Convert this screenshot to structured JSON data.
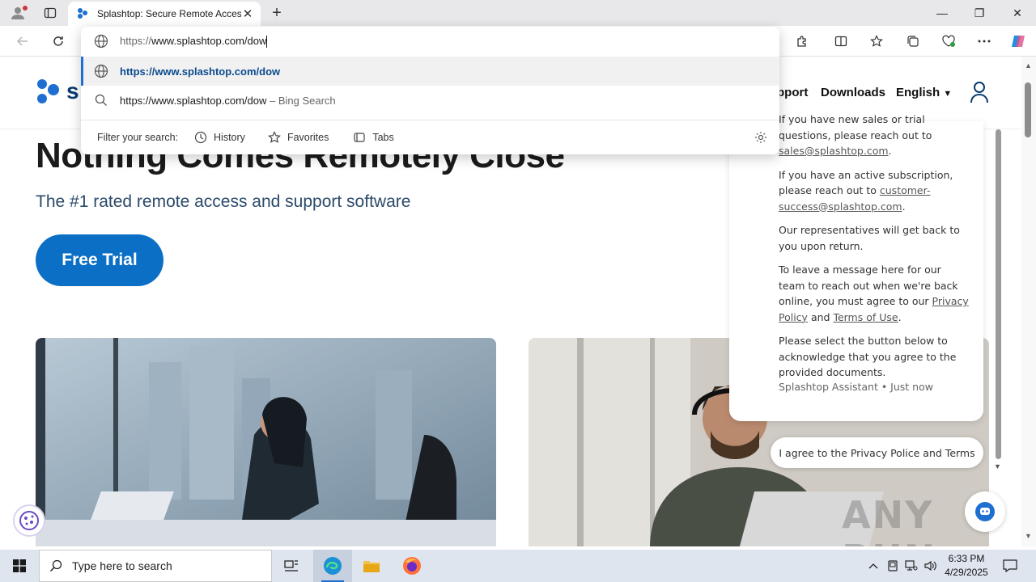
{
  "browser": {
    "tab_title": "Splashtop: Secure Remote Access",
    "new_tab": "+",
    "window_controls": {
      "minimize": "—",
      "restore": "❐",
      "close": "✕"
    }
  },
  "omnibox": {
    "typed_prefix": "https://",
    "typed_rest": "www.splashtop.com/dow",
    "suggestions": [
      {
        "text": "https://www.splashtop.com/dow",
        "suffix": "",
        "kind": "url"
      },
      {
        "text": "https://www.splashtop.com/dow",
        "suffix": " – Bing Search",
        "kind": "search"
      }
    ],
    "filter_label": "Filter your search:",
    "filters": [
      "History",
      "Favorites",
      "Tabs"
    ]
  },
  "site": {
    "logo_text": "s",
    "nav": {
      "support": "pport",
      "downloads": "Downloads",
      "language": "English"
    },
    "hero_title": "Nothing Comes Remotely Close",
    "hero_subtitle": "The #1 rated remote access and support software",
    "cta": "Free Trial"
  },
  "chat": {
    "p1_a": "If you have new sales or trial questions, please reach out to ",
    "p1_link": "sales@splashtop.com",
    "p1_b": ".",
    "p2_a": "If you have an active subscription, please reach out to ",
    "p2_link": "customer-success@splashtop.com",
    "p2_b": ".",
    "p3": "Our representatives will get back to you upon return.",
    "p4_a": "To leave a message here for our team to reach out when we're back online, you must agree to our ",
    "p4_link1": "Privacy Policy",
    "p4_and": " and ",
    "p4_link2": "Terms of Use",
    "p4_b": ".",
    "p5": "Please select the button below to acknowledge that you agree to the provided documents.",
    "meta": "Splashtop Assistant • Just now",
    "agree_button": "I agree to the Privacy Police and Terms"
  },
  "watermark": "ANY RUN",
  "taskbar": {
    "search_placeholder": "Type here to search",
    "time": "6:33 PM",
    "date": "4/29/2025"
  }
}
